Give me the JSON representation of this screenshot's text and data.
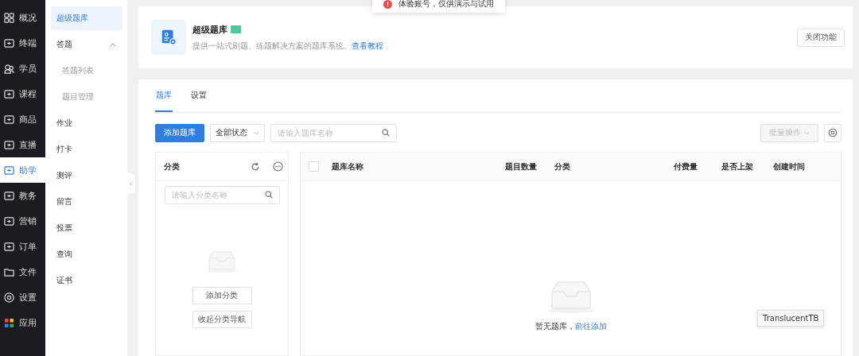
{
  "nav": [
    {
      "label": "概况",
      "selected": false
    },
    {
      "label": "终端",
      "selected": false
    },
    {
      "label": "学员",
      "selected": false
    },
    {
      "label": "课程",
      "selected": false
    },
    {
      "label": "商品",
      "selected": false
    },
    {
      "label": "直播",
      "selected": false
    },
    {
      "label": "助学",
      "selected": true
    },
    {
      "label": "教务",
      "selected": false
    },
    {
      "label": "营销",
      "selected": false
    },
    {
      "label": "订单",
      "selected": false
    },
    {
      "label": "文件",
      "selected": false
    },
    {
      "label": "设置",
      "selected": false
    },
    {
      "label": "应用",
      "selected": false
    }
  ],
  "subnav": [
    {
      "label": "超级题库",
      "selected": true
    },
    {
      "label": "答题",
      "selected": false,
      "expanded": true,
      "children": [
        {
          "label": "答题列表",
          "selected": false
        },
        {
          "label": "题目管理",
          "selected": false
        }
      ]
    },
    {
      "label": "作业",
      "selected": false
    },
    {
      "label": "打卡",
      "selected": false
    },
    {
      "label": "测评",
      "selected": false
    },
    {
      "label": "留言",
      "selected": false
    },
    {
      "label": "投票",
      "selected": false
    },
    {
      "label": "查询",
      "selected": false
    },
    {
      "label": "证书",
      "selected": false
    }
  ],
  "toast": {
    "text": "体验账号，仅供演示与试用"
  },
  "header": {
    "title": "超级题库",
    "description": "提供一站式刷题、练题解决方案的题库系统。",
    "link": "查看教程",
    "button": "关闭功能"
  },
  "tabs": [
    {
      "label": "题库",
      "selected": true
    },
    {
      "label": "设置",
      "selected": false
    }
  ],
  "toolbar": {
    "add_button": "添加题库",
    "status_select": "全部状态",
    "search": {
      "placeholder": "请输入题库名称"
    },
    "batch_button": {
      "label": "批量操作",
      "disabled": true
    }
  },
  "category_panel": {
    "title": "分类",
    "search": {
      "placeholder": "请输入分类名称"
    },
    "buttons": [
      "添加分类",
      "收起分类导航"
    ]
  },
  "table": {
    "select_all_checked": false,
    "columns": [
      "题库名称",
      "题目数量",
      "分类",
      "付费量",
      "是否上架",
      "创建时间"
    ],
    "empty_text": "暂无题库，",
    "empty_link": "前往添加"
  },
  "tooltip": {
    "text": "TranslucentTB"
  }
}
